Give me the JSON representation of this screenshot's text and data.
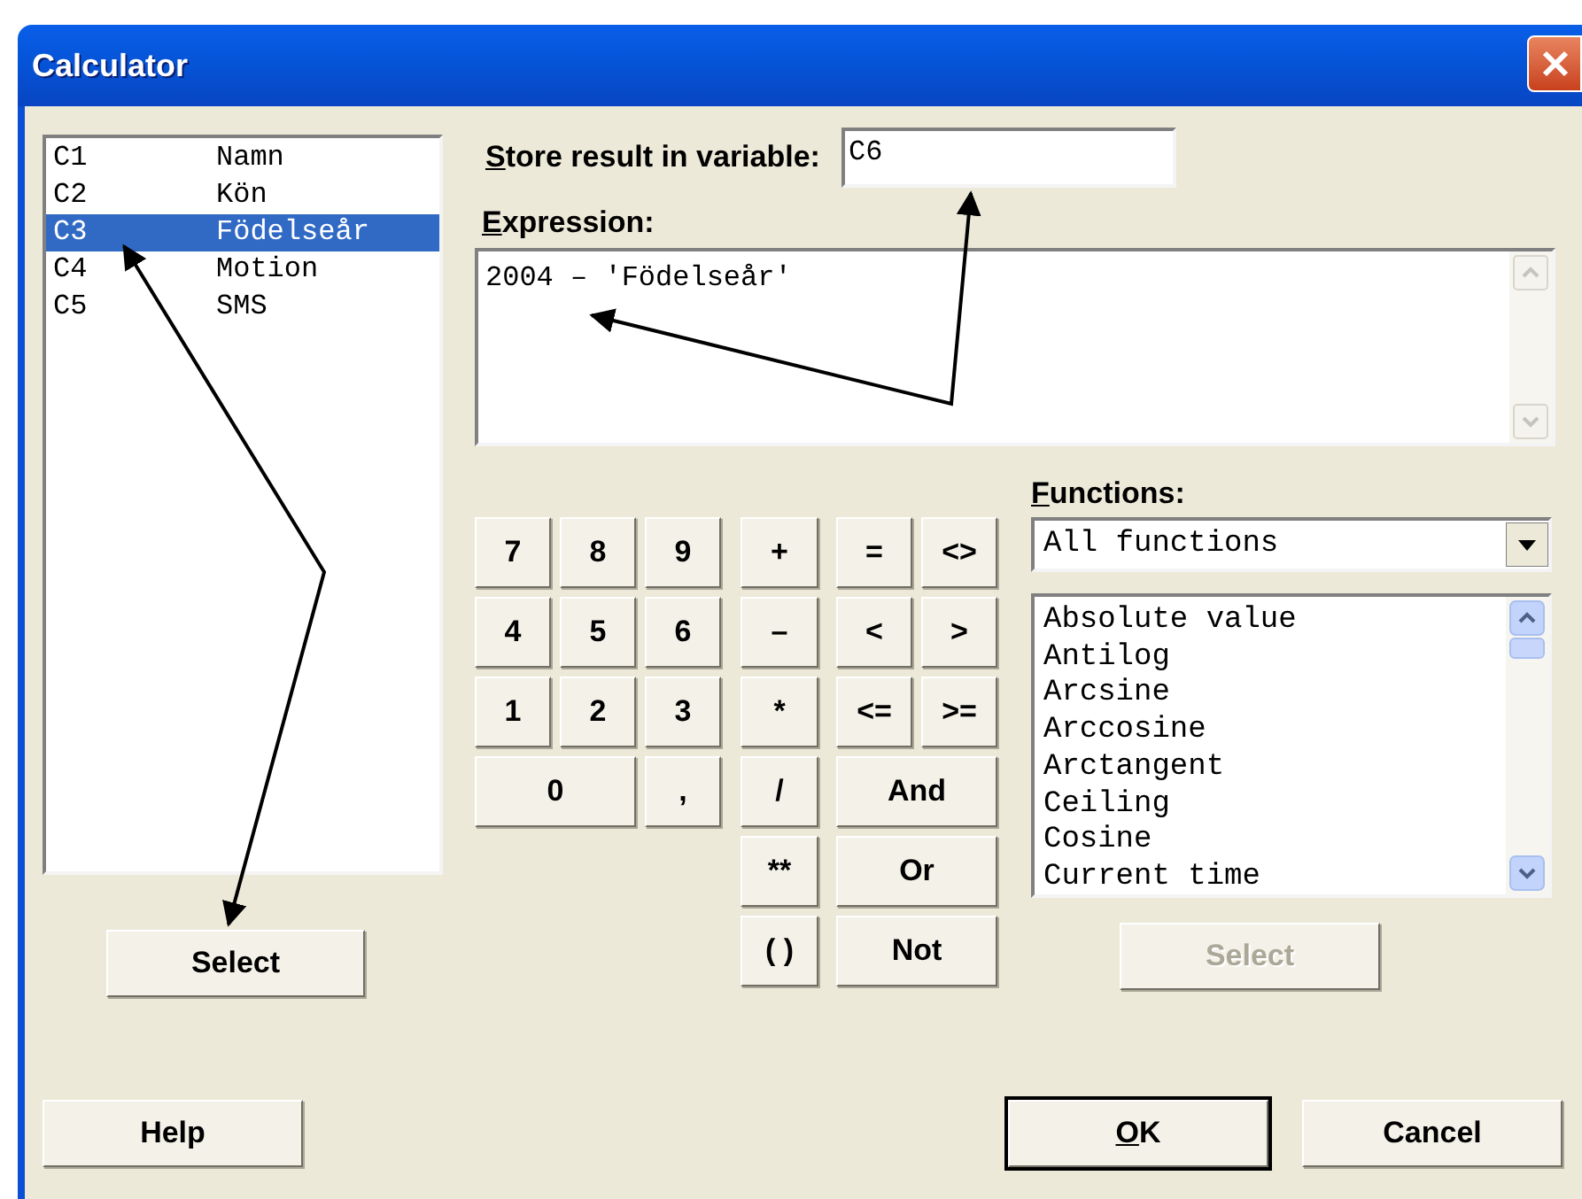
{
  "window": {
    "title": "Calculator"
  },
  "variables": [
    {
      "column": "C1",
      "name": "Namn",
      "selected": false
    },
    {
      "column": "C2",
      "name": "Kön",
      "selected": false
    },
    {
      "column": "C3",
      "name": "Födelseår",
      "selected": true
    },
    {
      "column": "C4",
      "name": "Motion",
      "selected": false
    },
    {
      "column": "C5",
      "name": "SMS",
      "selected": false
    }
  ],
  "variables_select_button": {
    "label": "Select",
    "disabled": false
  },
  "store_result": {
    "label": "Store result in variable:",
    "mnemonic": true,
    "value": "C6"
  },
  "expression": {
    "label": "Expression:",
    "mnemonic": true,
    "value": "2004 – 'Födelseår'"
  },
  "number_pad": [
    "7",
    "8",
    "9",
    "4",
    "5",
    "6",
    "1",
    "2",
    "3",
    "0",
    ","
  ],
  "arithmetic_keys": [
    "+",
    "–",
    "*",
    "/",
    "**",
    "( )"
  ],
  "comparison_keys": [
    "=",
    "<>",
    "<",
    ">",
    "<=",
    ">=",
    "And",
    "Or",
    "Not"
  ],
  "functions": {
    "label": "Functions:",
    "mnemonic": true,
    "category": "All functions",
    "items": [
      "Absolute value",
      "Antilog",
      "Arcsine",
      "Arccosine",
      "Arctangent",
      "Ceiling",
      "Cosine",
      "Current time"
    ],
    "select_button": {
      "label": "Select",
      "disabled": true
    }
  },
  "buttons": [
    {
      "label": "Help",
      "mnemonic": false,
      "default": false
    },
    {
      "label": "OK",
      "mnemonic": true,
      "default": true
    },
    {
      "label": "Cancel",
      "mnemonic": false,
      "default": false
    }
  ]
}
